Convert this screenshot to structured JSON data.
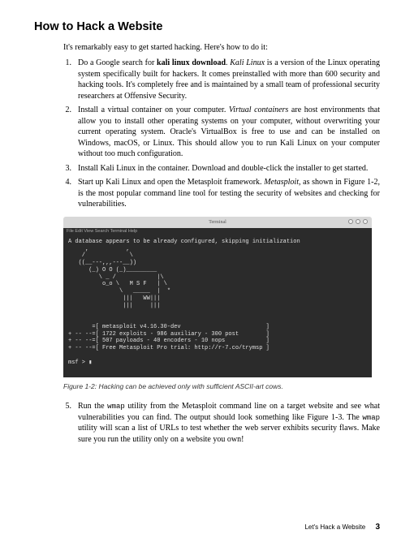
{
  "title": "How to Hack a Website",
  "intro": "It's remarkably easy to get started hacking. Here's how to do it:",
  "steps": [
    {
      "num": "1.",
      "parts": [
        {
          "t": "Do a Google search for "
        },
        {
          "t": "kali linux download",
          "cls": "b"
        },
        {
          "t": ". "
        },
        {
          "t": "Kali Linux",
          "cls": "i"
        },
        {
          "t": " is a version of the Linux operating system specifically built for hackers. It comes preinstalled with more than 600 security and hacking tools. It's completely free and is maintained by a small team of professional security researchers at Offensive Security."
        }
      ]
    },
    {
      "num": "2.",
      "parts": [
        {
          "t": "Install a virtual container on your computer. "
        },
        {
          "t": "Virtual containers",
          "cls": "i"
        },
        {
          "t": " are host environments that allow you to install other operating systems on your computer, without overwriting your current operating system. Oracle's VirtualBox is free to use and can be installed on Windows, macOS, or Linux. This should allow you to run Kali Linux on your computer without too much configuration."
        }
      ]
    },
    {
      "num": "3.",
      "parts": [
        {
          "t": "Install Kali Linux in the container. Download and double-click the installer to get started."
        }
      ]
    },
    {
      "num": "4.",
      "parts": [
        {
          "t": "Start up Kali Linux and open the Metasploit framework. "
        },
        {
          "t": "Metasploit",
          "cls": "i"
        },
        {
          "t": ", as shown in Figure 1-2, is the most popular command line tool for testing the security of websites and checking for vulnerabilities."
        }
      ]
    }
  ],
  "terminal": {
    "title": "Terminal",
    "menu": "File  Edit  View  Search  Terminal  Help",
    "body": "A database appears to be already configured, skipping initialization\n     ,           ,\n    /             \\\n   ((__---,,,---__))\n      (_) O O (_)_________\n         \\ _ /            |\\\n          o_o \\   M S F   | \\\n               \\   _____  |  *\n                |||   WW|||\n                |||     |||\n\n\n       =[ metasploit v4.16.30-dev                         ]\n+ -- --=[ 1722 exploits - 986 auxiliary - 300 post        ]\n+ -- --=[ 507 payloads - 40 encoders - 10 nops            ]\n+ -- --=[ Free Metasploit Pro trial: http://r-7.co/trymsp ]\n\nmsf > ▮"
  },
  "caption": "Figure 1-2: Hacking can be achieved only with sufficient ASCII-art cows.",
  "step5": {
    "num": "5.",
    "parts": [
      {
        "t": "Run the "
      },
      {
        "t": "wmap",
        "cls": "mono"
      },
      {
        "t": " utility from the Metasploit command line on a target website and see what vulnerabilities you can find. The output should look something like Figure 1-3. The "
      },
      {
        "t": "wmap",
        "cls": "mono"
      },
      {
        "t": " utility will scan a list of URLs to test whether the web server exhibits security flaws. Make sure you run the utility only on a website you own!"
      }
    ]
  },
  "footer": {
    "section": "Let's Hack a Website",
    "page": "3"
  }
}
